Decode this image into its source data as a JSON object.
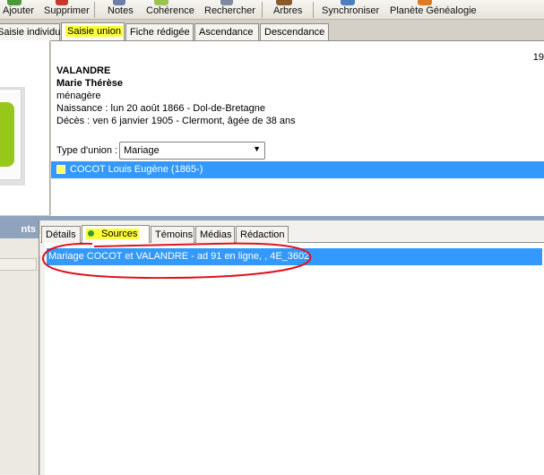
{
  "toolbar": {
    "items": [
      {
        "label": "Ajouter",
        "icon": "add-icon"
      },
      {
        "label": "Supprimer",
        "icon": "delete-icon"
      },
      {
        "label": "Notes",
        "icon": "notes-icon"
      },
      {
        "label": "Cohérence",
        "icon": "coherence-icon"
      },
      {
        "label": "Rechercher",
        "icon": "search-icon"
      },
      {
        "label": "Arbres",
        "icon": "tree-icon"
      },
      {
        "label": "Synchroniser",
        "icon": "sync-icon"
      },
      {
        "label": "Planète Généalogie",
        "icon": "planet-icon"
      }
    ]
  },
  "tabs": [
    "Saisie individu",
    "Saisie union",
    "Fiche rédigée",
    "Ascendance",
    "Descendance"
  ],
  "active_tab": "Saisie union",
  "person": {
    "page_number": "19",
    "surname": "VALANDRE",
    "firstname": "Marie Thérèse",
    "occupation": "ménagère",
    "birth": "Naissance : lun 20 août 1866 - Dol-de-Bretagne",
    "death": "Décès : ven 6 janvier 1905 - Clermont, âgée de 38 ans"
  },
  "union": {
    "type_label": "Type d'union :",
    "type_value": "Mariage",
    "spouse": "COCOT Louis Eugène (1865-)"
  },
  "left_panel_title": "nts",
  "lower_tabs": [
    "Détails",
    "Sources",
    "Témoins",
    "Médias",
    "Rédaction"
  ],
  "active_lower_tab": "Sources",
  "sources": [
    "Mariage COCOT et VALANDRE - ad 91 en ligne, , 4E_3602"
  ],
  "colors": {
    "selection": "#3399ff",
    "highlight": "#ffff3a",
    "annotation": "#e0121c",
    "splitter": "#8fa3bd",
    "status_dot": "#3b9b2a"
  }
}
